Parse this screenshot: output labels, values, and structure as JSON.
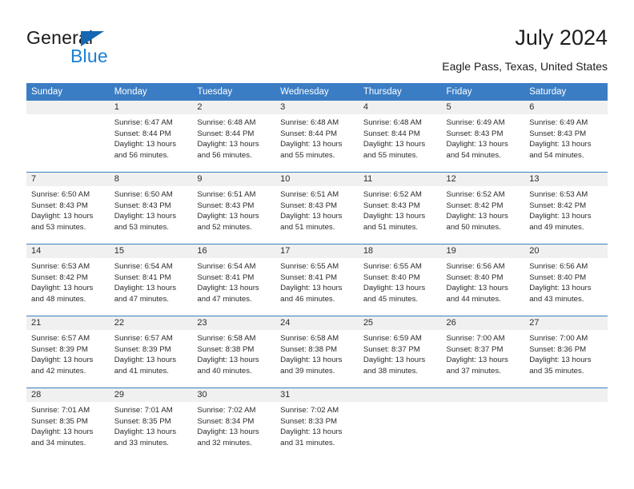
{
  "brand": {
    "name_part1": "General",
    "name_part2": "Blue",
    "triangle_icon": "triangle-icon",
    "colors": {
      "dark_text": "#1a1a1a",
      "blue_text": "#1a7fd4",
      "triangle": "#1567b2"
    }
  },
  "header": {
    "title": "July 2024",
    "subtitle": "Eagle Pass, Texas, United States"
  },
  "calendar": {
    "accent_color": "#3a7dc4",
    "daynum_band_color": "#f0f0f0",
    "weekday_headers": [
      "Sunday",
      "Monday",
      "Tuesday",
      "Wednesday",
      "Thursday",
      "Friday",
      "Saturday"
    ],
    "weeks": [
      [
        {
          "day": "",
          "sunrise": "",
          "sunset": "",
          "daylight_line1": "",
          "daylight_line2": "",
          "empty": true
        },
        {
          "day": "1",
          "sunrise": "Sunrise: 6:47 AM",
          "sunset": "Sunset: 8:44 PM",
          "daylight_line1": "Daylight: 13 hours",
          "daylight_line2": "and 56 minutes.",
          "empty": false
        },
        {
          "day": "2",
          "sunrise": "Sunrise: 6:48 AM",
          "sunset": "Sunset: 8:44 PM",
          "daylight_line1": "Daylight: 13 hours",
          "daylight_line2": "and 56 minutes.",
          "empty": false
        },
        {
          "day": "3",
          "sunrise": "Sunrise: 6:48 AM",
          "sunset": "Sunset: 8:44 PM",
          "daylight_line1": "Daylight: 13 hours",
          "daylight_line2": "and 55 minutes.",
          "empty": false
        },
        {
          "day": "4",
          "sunrise": "Sunrise: 6:48 AM",
          "sunset": "Sunset: 8:44 PM",
          "daylight_line1": "Daylight: 13 hours",
          "daylight_line2": "and 55 minutes.",
          "empty": false
        },
        {
          "day": "5",
          "sunrise": "Sunrise: 6:49 AM",
          "sunset": "Sunset: 8:43 PM",
          "daylight_line1": "Daylight: 13 hours",
          "daylight_line2": "and 54 minutes.",
          "empty": false
        },
        {
          "day": "6",
          "sunrise": "Sunrise: 6:49 AM",
          "sunset": "Sunset: 8:43 PM",
          "daylight_line1": "Daylight: 13 hours",
          "daylight_line2": "and 54 minutes.",
          "empty": false
        }
      ],
      [
        {
          "day": "7",
          "sunrise": "Sunrise: 6:50 AM",
          "sunset": "Sunset: 8:43 PM",
          "daylight_line1": "Daylight: 13 hours",
          "daylight_line2": "and 53 minutes.",
          "empty": false
        },
        {
          "day": "8",
          "sunrise": "Sunrise: 6:50 AM",
          "sunset": "Sunset: 8:43 PM",
          "daylight_line1": "Daylight: 13 hours",
          "daylight_line2": "and 53 minutes.",
          "empty": false
        },
        {
          "day": "9",
          "sunrise": "Sunrise: 6:51 AM",
          "sunset": "Sunset: 8:43 PM",
          "daylight_line1": "Daylight: 13 hours",
          "daylight_line2": "and 52 minutes.",
          "empty": false
        },
        {
          "day": "10",
          "sunrise": "Sunrise: 6:51 AM",
          "sunset": "Sunset: 8:43 PM",
          "daylight_line1": "Daylight: 13 hours",
          "daylight_line2": "and 51 minutes.",
          "empty": false
        },
        {
          "day": "11",
          "sunrise": "Sunrise: 6:52 AM",
          "sunset": "Sunset: 8:43 PM",
          "daylight_line1": "Daylight: 13 hours",
          "daylight_line2": "and 51 minutes.",
          "empty": false
        },
        {
          "day": "12",
          "sunrise": "Sunrise: 6:52 AM",
          "sunset": "Sunset: 8:42 PM",
          "daylight_line1": "Daylight: 13 hours",
          "daylight_line2": "and 50 minutes.",
          "empty": false
        },
        {
          "day": "13",
          "sunrise": "Sunrise: 6:53 AM",
          "sunset": "Sunset: 8:42 PM",
          "daylight_line1": "Daylight: 13 hours",
          "daylight_line2": "and 49 minutes.",
          "empty": false
        }
      ],
      [
        {
          "day": "14",
          "sunrise": "Sunrise: 6:53 AM",
          "sunset": "Sunset: 8:42 PM",
          "daylight_line1": "Daylight: 13 hours",
          "daylight_line2": "and 48 minutes.",
          "empty": false
        },
        {
          "day": "15",
          "sunrise": "Sunrise: 6:54 AM",
          "sunset": "Sunset: 8:41 PM",
          "daylight_line1": "Daylight: 13 hours",
          "daylight_line2": "and 47 minutes.",
          "empty": false
        },
        {
          "day": "16",
          "sunrise": "Sunrise: 6:54 AM",
          "sunset": "Sunset: 8:41 PM",
          "daylight_line1": "Daylight: 13 hours",
          "daylight_line2": "and 47 minutes.",
          "empty": false
        },
        {
          "day": "17",
          "sunrise": "Sunrise: 6:55 AM",
          "sunset": "Sunset: 8:41 PM",
          "daylight_line1": "Daylight: 13 hours",
          "daylight_line2": "and 46 minutes.",
          "empty": false
        },
        {
          "day": "18",
          "sunrise": "Sunrise: 6:55 AM",
          "sunset": "Sunset: 8:40 PM",
          "daylight_line1": "Daylight: 13 hours",
          "daylight_line2": "and 45 minutes.",
          "empty": false
        },
        {
          "day": "19",
          "sunrise": "Sunrise: 6:56 AM",
          "sunset": "Sunset: 8:40 PM",
          "daylight_line1": "Daylight: 13 hours",
          "daylight_line2": "and 44 minutes.",
          "empty": false
        },
        {
          "day": "20",
          "sunrise": "Sunrise: 6:56 AM",
          "sunset": "Sunset: 8:40 PM",
          "daylight_line1": "Daylight: 13 hours",
          "daylight_line2": "and 43 minutes.",
          "empty": false
        }
      ],
      [
        {
          "day": "21",
          "sunrise": "Sunrise: 6:57 AM",
          "sunset": "Sunset: 8:39 PM",
          "daylight_line1": "Daylight: 13 hours",
          "daylight_line2": "and 42 minutes.",
          "empty": false
        },
        {
          "day": "22",
          "sunrise": "Sunrise: 6:57 AM",
          "sunset": "Sunset: 8:39 PM",
          "daylight_line1": "Daylight: 13 hours",
          "daylight_line2": "and 41 minutes.",
          "empty": false
        },
        {
          "day": "23",
          "sunrise": "Sunrise: 6:58 AM",
          "sunset": "Sunset: 8:38 PM",
          "daylight_line1": "Daylight: 13 hours",
          "daylight_line2": "and 40 minutes.",
          "empty": false
        },
        {
          "day": "24",
          "sunrise": "Sunrise: 6:58 AM",
          "sunset": "Sunset: 8:38 PM",
          "daylight_line1": "Daylight: 13 hours",
          "daylight_line2": "and 39 minutes.",
          "empty": false
        },
        {
          "day": "25",
          "sunrise": "Sunrise: 6:59 AM",
          "sunset": "Sunset: 8:37 PM",
          "daylight_line1": "Daylight: 13 hours",
          "daylight_line2": "and 38 minutes.",
          "empty": false
        },
        {
          "day": "26",
          "sunrise": "Sunrise: 7:00 AM",
          "sunset": "Sunset: 8:37 PM",
          "daylight_line1": "Daylight: 13 hours",
          "daylight_line2": "and 37 minutes.",
          "empty": false
        },
        {
          "day": "27",
          "sunrise": "Sunrise: 7:00 AM",
          "sunset": "Sunset: 8:36 PM",
          "daylight_line1": "Daylight: 13 hours",
          "daylight_line2": "and 35 minutes.",
          "empty": false
        }
      ],
      [
        {
          "day": "28",
          "sunrise": "Sunrise: 7:01 AM",
          "sunset": "Sunset: 8:35 PM",
          "daylight_line1": "Daylight: 13 hours",
          "daylight_line2": "and 34 minutes.",
          "empty": false
        },
        {
          "day": "29",
          "sunrise": "Sunrise: 7:01 AM",
          "sunset": "Sunset: 8:35 PM",
          "daylight_line1": "Daylight: 13 hours",
          "daylight_line2": "and 33 minutes.",
          "empty": false
        },
        {
          "day": "30",
          "sunrise": "Sunrise: 7:02 AM",
          "sunset": "Sunset: 8:34 PM",
          "daylight_line1": "Daylight: 13 hours",
          "daylight_line2": "and 32 minutes.",
          "empty": false
        },
        {
          "day": "31",
          "sunrise": "Sunrise: 7:02 AM",
          "sunset": "Sunset: 8:33 PM",
          "daylight_line1": "Daylight: 13 hours",
          "daylight_line2": "and 31 minutes.",
          "empty": false
        },
        {
          "day": "",
          "sunrise": "",
          "sunset": "",
          "daylight_line1": "",
          "daylight_line2": "",
          "empty": true
        },
        {
          "day": "",
          "sunrise": "",
          "sunset": "",
          "daylight_line1": "",
          "daylight_line2": "",
          "empty": true
        },
        {
          "day": "",
          "sunrise": "",
          "sunset": "",
          "daylight_line1": "",
          "daylight_line2": "",
          "empty": true
        }
      ]
    ]
  }
}
